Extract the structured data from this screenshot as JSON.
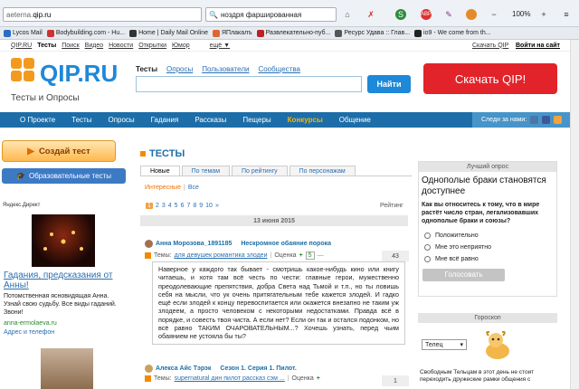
{
  "browser": {
    "url_prefix": "aeterna.",
    "url_domain": "qip.ru",
    "search_value": "ноздря фаршированная",
    "zoom": "100%",
    "bookmarks": [
      {
        "label": "Lycos Mail",
        "color": "#2b6cc4"
      },
      {
        "label": "Bodybuilding.com - Hu...",
        "color": "#c33"
      },
      {
        "label": "Home | Daily Mail Online",
        "color": "#333"
      },
      {
        "label": "ЯПлакалъ",
        "color": "#d63"
      },
      {
        "label": "Развлекательно-пуб...",
        "color": "#b22"
      },
      {
        "label": "Ресурс Удава :: Глав...",
        "color": "#555"
      },
      {
        "label": "io9 - We come from th...",
        "color": "#222"
      }
    ]
  },
  "topnav": {
    "items": [
      "QIP.RU",
      "Тесты",
      "Поиск",
      "Видео",
      "Новости",
      "Открытки",
      "Юмор",
      "ещё ▼"
    ],
    "download": "Скачать QIP",
    "login": "Войти на сайт"
  },
  "header": {
    "logo": "QIP.RU",
    "subtitle": "Тесты и Опросы",
    "tabs": [
      "Тесты",
      "Опросы",
      "Пользователи",
      "Сообщества"
    ],
    "search_button": "Найти",
    "download_button": "Скачать QIP!"
  },
  "mainnav": {
    "items": [
      "О Проекте",
      "Тесты",
      "Опросы",
      "Гадания",
      "Рассказы",
      "Пещеры",
      "Конкурсы",
      "Общение"
    ],
    "follow": "Следи за нами:"
  },
  "left": {
    "create_test": "Создай тест",
    "edu_tests": "Образовательные тесты",
    "ad_label": "Яндекс.Директ",
    "ad_title": "Гадания, предсказания от Анны!",
    "ad_text": "Потомственная ясновидящая Анна. Узнай свою судьбу. Все виды гаданий. Звони!",
    "ad_url": "anna-ermolaeva.ru",
    "ad_phone": "Адрес и телефон"
  },
  "center": {
    "title": "ТЕСТЫ",
    "tabs": [
      "Новые",
      "По темам",
      "По рейтингу",
      "По персонажам"
    ],
    "filter_interesting": "Интересные",
    "filter_sep": "|",
    "filter_all": "Все",
    "pages": [
      "1",
      "2",
      "3",
      "4",
      "5",
      "6",
      "7",
      "8",
      "9",
      "10",
      "»"
    ],
    "rating_label": "Рейтинг",
    "date": "13 июня 2015",
    "posts": [
      {
        "author": "Анна Морозова_1891185",
        "title": "Нескромное обаяние порока",
        "tags_label": "Темы:",
        "tags": "для девушек романтика злодеи",
        "rating_label": "Оценка",
        "plus": "+",
        "count": "5",
        "minus": "—",
        "score": "43",
        "text": "Наверное у каждого так бывает - смотришь какое-нибудь кино или книгу читаешь, и хотя там всё честь по чести: главные герои, мужественно преодолевающие препятствия, добра Света над Тьмой и т.п., но ты ловишь себя на мысли, что ук очень притягательным тебе кажется злодей. И гадко ещё если злодей к концу перевоспитается или окажется внезапно не таким уж злодеем, а просто человеком с некоторыми недостатками. Правда всё в порядке, и совесть твоя чиста. А если нет? Если он так и остался подонком, но всё равно ТАКИМ ОЧАРОВАТЕЛЬНЫМ...? Хочешь узнать, перед чьим обаянием не устояла бы ты?"
      },
      {
        "author": "Алекса Айс Тэрэк",
        "title": "Сезон 1. Серия 1. Пилот.",
        "tags_label": "Темы:",
        "tags": "supernatural дин пилот рассказ сэм ...",
        "rating_label": "Оценка",
        "plus": "+",
        "count": "",
        "minus": "",
        "score": "1",
        "text": ""
      }
    ]
  },
  "right": {
    "poll_header": "Лучший опрос",
    "poll_question": "Однополые браки становятся доступнее",
    "poll_sub": "Как вы относитесь к тому, что в мире растёт число стран, легализовавших однополые браки и союзы?",
    "options": [
      "Положительно",
      "Мне это неприятно",
      "Мне всё равно"
    ],
    "vote": "Голосовать",
    "horo_header": "Гороскоп",
    "horo_sign": "Телец",
    "horo_text": "Свободным Тельцам в этот день не стоит переходить дружеские рамки общения с"
  },
  "colors": {
    "accent": "#1d6ea8",
    "orange": "#f28a00",
    "red": "#e3232a",
    "green": "#2a8a2a"
  }
}
